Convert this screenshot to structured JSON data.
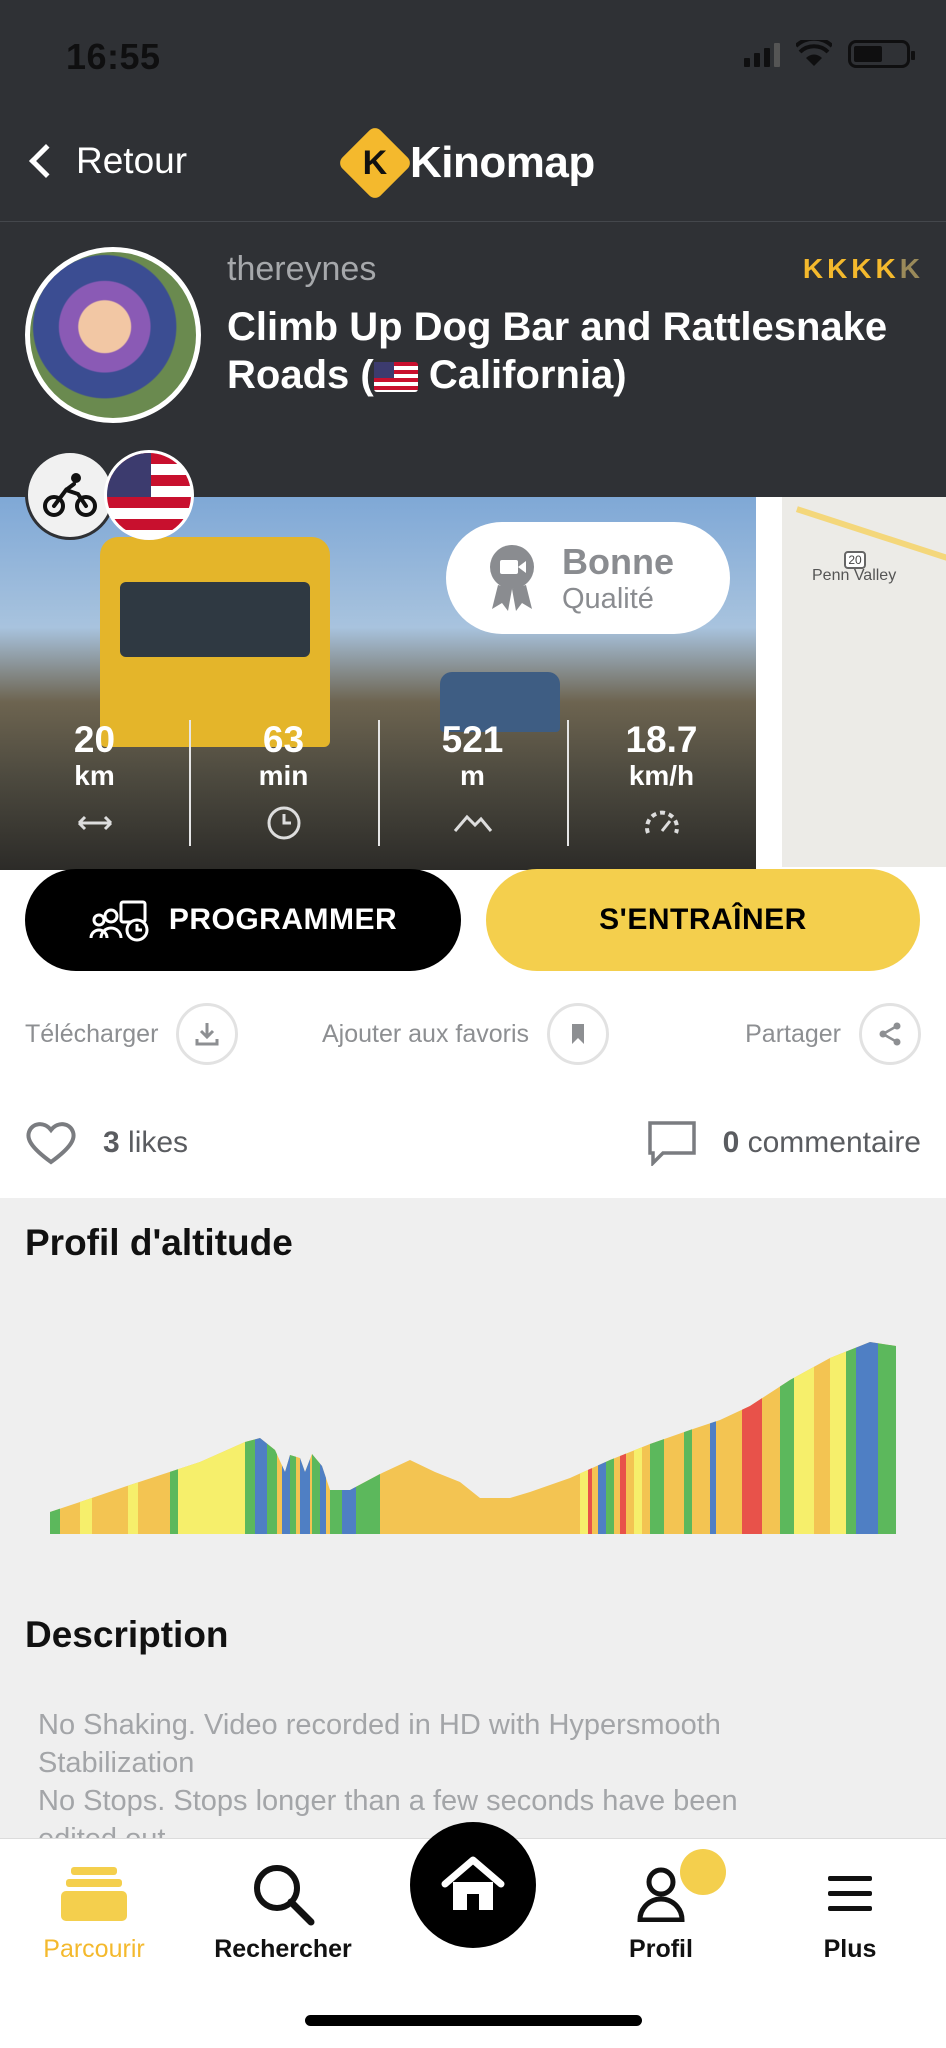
{
  "status_bar": {
    "time": "16:55"
  },
  "nav": {
    "back_label": "Retour",
    "logo_text": "Kinomap",
    "logo_letter": "K"
  },
  "route": {
    "author": "thereynes",
    "title_main": "Climb Up Dog Bar and Rattlesnake Roads (",
    "title_location": "California)",
    "rating_letters": [
      "K",
      "K",
      "K",
      "K",
      "K"
    ],
    "rating_value": 4,
    "rating_max": 5
  },
  "quality": {
    "label": "Bonne",
    "sublabel": "Qualité"
  },
  "stats": [
    {
      "value": "20",
      "unit": "km",
      "icon": "distance-arrows-icon"
    },
    {
      "value": "63",
      "unit": "min",
      "icon": "clock-icon"
    },
    {
      "value": "521",
      "unit": "m",
      "icon": "elevation-icon"
    },
    {
      "value": "18.7",
      "unit": "km/h",
      "icon": "speedometer-icon"
    }
  ],
  "map": {
    "road_badge": "20",
    "place": "Penn Valley"
  },
  "buttons": {
    "program": "PROGRAMMER",
    "train": "S'ENTRAÎNER"
  },
  "actions": {
    "download": "Télécharger",
    "favorite": "Ajouter aux favoris",
    "share": "Partager"
  },
  "social": {
    "likes_count": "3",
    "likes_label": "likes",
    "comments_count": "0",
    "comments_label": "commentaire"
  },
  "elevation": {
    "title": "Profil d'altitude",
    "colors": {
      "yellow": "#f6ef6b",
      "orange": "#f3c452",
      "green": "#5cb85c",
      "blue": "#4f7fc4",
      "red": "#e8524a"
    }
  },
  "description": {
    "title": "Description",
    "lines": [
      "No Shaking. Video recorded in HD with Hypersmooth",
      "Stabilization",
      "No Stops. Stops longer than a few seconds have been",
      "edited out."
    ]
  },
  "tabbar": {
    "items": [
      {
        "label": "Parcourir",
        "icon": "layers-icon",
        "active": true
      },
      {
        "label": "Rechercher",
        "icon": "search-icon",
        "active": false
      },
      {
        "label": "",
        "icon": "home-icon",
        "active": false
      },
      {
        "label": "Profil",
        "icon": "user-icon",
        "active": false
      },
      {
        "label": "Plus",
        "icon": "menu-icon",
        "active": false
      }
    ]
  },
  "colors": {
    "header_bg": "#2f3135",
    "accent_yellow": "#f4cf4d",
    "brand_orange": "#f4b92d"
  }
}
